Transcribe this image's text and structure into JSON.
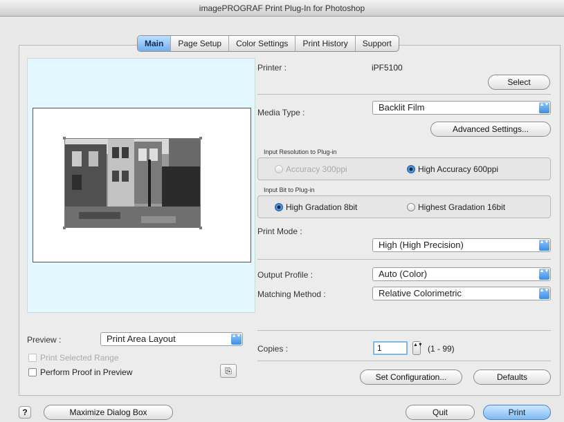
{
  "window": {
    "title": "imagePROGRAF Print Plug-In for Photoshop"
  },
  "tabs": [
    {
      "label": "Main",
      "active": true
    },
    {
      "label": "Page Setup",
      "active": false
    },
    {
      "label": "Color Settings",
      "active": false
    },
    {
      "label": "Print History",
      "active": false
    },
    {
      "label": "Support",
      "active": false
    }
  ],
  "printer": {
    "label": "Printer :",
    "value": "iPF5100",
    "select_label": "Select"
  },
  "media": {
    "label": "Media Type :",
    "value": "Backlit Film",
    "advanced_label": "Advanced Settings..."
  },
  "input_resolution": {
    "group_label": "Input Resolution to Plug-in",
    "options": [
      {
        "label": "Accuracy 300ppi",
        "selected": false,
        "disabled": true
      },
      {
        "label": "High Accuracy 600ppi",
        "selected": true,
        "disabled": false
      }
    ]
  },
  "input_bit": {
    "group_label": "Input Bit to Plug-in",
    "options": [
      {
        "label": "High Gradation 8bit",
        "selected": true
      },
      {
        "label": "Highest Gradation 16bit",
        "selected": false
      }
    ]
  },
  "print_mode": {
    "label": "Print Mode :",
    "value": "High (High Precision)"
  },
  "output_profile": {
    "label": "Output Profile :",
    "value": "Auto (Color)"
  },
  "matching_method": {
    "label": "Matching Method :",
    "value": "Relative Colorimetric"
  },
  "preview": {
    "label": "Preview :",
    "value": "Print Area Layout",
    "print_selected_range": "Print Selected Range",
    "perform_proof": "Perform Proof in Preview",
    "proof_icon_glyph": "⎘"
  },
  "copies": {
    "label": "Copies :",
    "value": "1",
    "range": "(1 - 99)"
  },
  "buttons": {
    "set_configuration": "Set Configuration...",
    "defaults": "Defaults",
    "maximize": "Maximize Dialog Box",
    "quit": "Quit",
    "print": "Print",
    "help": "?"
  },
  "icons": {
    "select_arrow": "▲▼",
    "stepper": "▲▼"
  }
}
